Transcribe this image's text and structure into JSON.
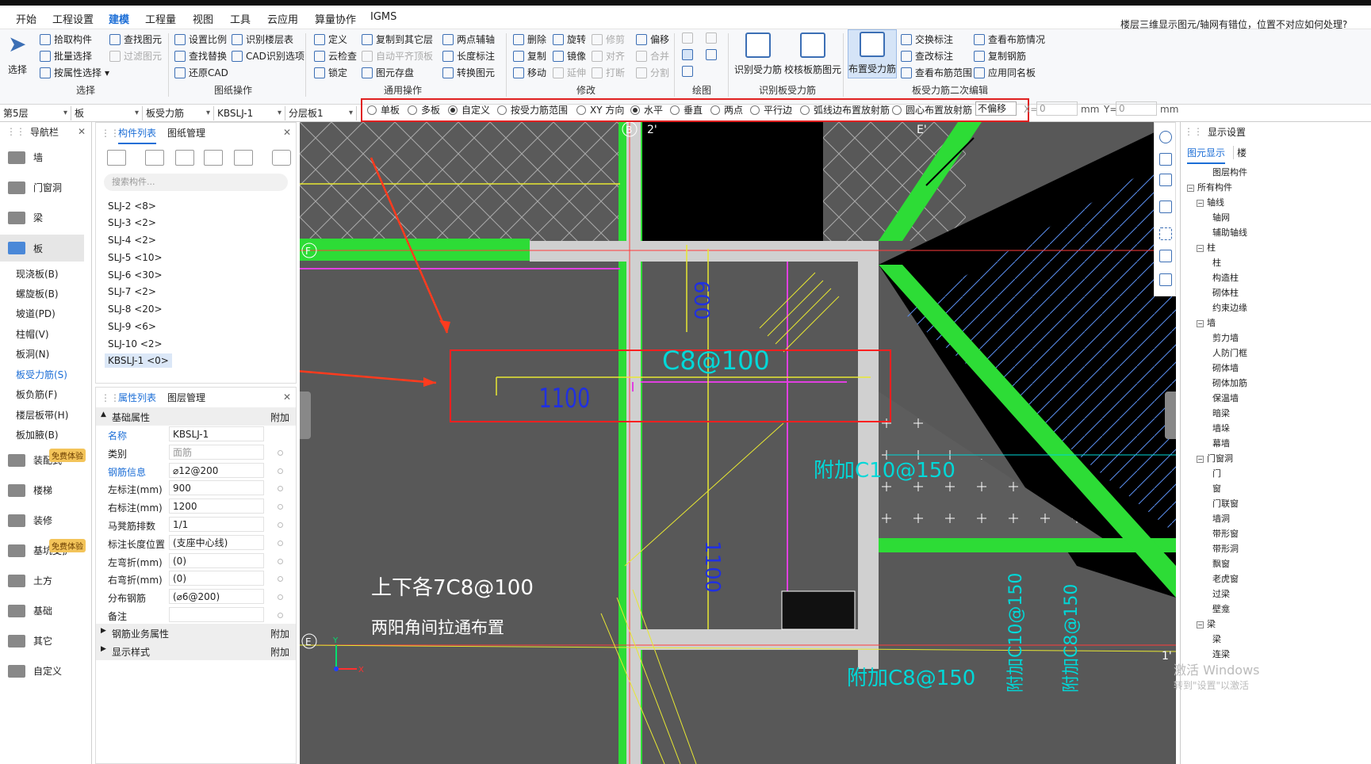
{
  "menu": [
    "开始",
    "工程设置",
    "建模",
    "工程量",
    "视图",
    "工具",
    "云应用",
    "算量协作",
    "IGMS"
  ],
  "hint": "楼层三维显示图元/轴网有错位，位置不对应如何处理?",
  "ribbon": {
    "select": {
      "big": "选择",
      "pick": "拾取构件",
      "batch": "批量选择",
      "byattr": "按属性选择",
      "group": "选择"
    },
    "find": {
      "findel": "查找图元",
      "filter": "过滤图元"
    },
    "drawing": {
      "scale": "设置比例",
      "replace": "查找替换",
      "restore": "还原CAD",
      "layer": "识别楼层表",
      "cadopt": "CAD识别选项",
      "group": "图纸操作"
    },
    "common": {
      "define": "定义",
      "cloud": "云检查",
      "lock": "锁定",
      "copyto": "复制到其它层",
      "autoflat": "自动平齐顶板",
      "store": "图元存盘",
      "twopt": "两点辅轴",
      "lenmark": "长度标注",
      "convert": "转换图元",
      "group": "通用操作"
    },
    "modify": {
      "delete": "删除",
      "copy": "复制",
      "move": "移动",
      "rotate": "旋转",
      "mirror": "镜像",
      "extend": "延伸",
      "trim": "修剪",
      "align": "对齐",
      "break": "打断",
      "offset": "偏移",
      "merge": "合并",
      "split": "分割",
      "group": "修改"
    },
    "draw": {
      "group": "绘图"
    },
    "recog": {
      "a": "识别受力筋",
      "b": "校核板筋图元",
      "group": "识别板受力筋"
    },
    "layout": {
      "big": "布置受力筋",
      "swap": "交换标注",
      "checklabel": "查改标注",
      "range": "查看布筋范围",
      "viewinfo": "查看布筋情况",
      "copyreb": "复制钢筋",
      "applysame": "应用同名板",
      "group": "板受力筋二次编辑"
    }
  },
  "propbar": {
    "floor": "第5层",
    "type": "板",
    "sub": "板受力筋",
    "comp": "KBSLJ-1",
    "layer": "分层板1"
  },
  "options": {
    "single": "单板",
    "multi": "多板",
    "custom": "自定义",
    "byrange": "按受力筋范围",
    "xy": "XY 方向",
    "horiz": "水平",
    "vert": "垂直",
    "twopt": "两点",
    "parallel": "平行边",
    "arc": "弧线边布置放射筋",
    "circle": "圆心布置放射筋",
    "offset": "不偏移",
    "x_label": "X=",
    "x_val": "0",
    "y_label": "Y=",
    "y_val": "0",
    "unit": "mm"
  },
  "nav": {
    "title": "导航栏",
    "items": [
      "墙",
      "门窗洞",
      "梁",
      "板"
    ],
    "subs": [
      "现浇板(B)",
      "螺旋板(B)",
      "坡道(PD)",
      "柱帽(V)",
      "板洞(N)",
      "板受力筋(S)",
      "板负筋(F)",
      "楼层板带(H)",
      "板加腋(B)"
    ],
    "more": [
      "装配式",
      "楼梯",
      "装修",
      "基坑支护",
      "土方",
      "基础",
      "其它",
      "自定义"
    ],
    "badge": "免费体验"
  },
  "complist": {
    "tab1": "构件列表",
    "tab2": "图纸管理",
    "search": "搜索构件...",
    "items": [
      "SLJ-2 <8>",
      "SLJ-3 <2>",
      "SLJ-4 <2>",
      "SLJ-5 <10>",
      "SLJ-6 <30>",
      "SLJ-7 <2>",
      "SLJ-8 <20>",
      "SLJ-9 <6>",
      "SLJ-10 <2>",
      "KBSLJ-1 <0>"
    ]
  },
  "proplist": {
    "tab1": "属性列表",
    "tab2": "图层管理",
    "base": "基础属性",
    "add": "附加",
    "rows": [
      [
        "名称",
        "KBSLJ-1"
      ],
      [
        "类别",
        "面筋"
      ],
      [
        "钢筋信息",
        "⌀12@200"
      ],
      [
        "左标注(mm)",
        "900"
      ],
      [
        "右标注(mm)",
        "1200"
      ],
      [
        "马凳筋排数",
        "1/1"
      ],
      [
        "标注长度位置",
        "(支座中心线)"
      ],
      [
        "左弯折(mm)",
        "(0)"
      ],
      [
        "右弯折(mm)",
        "(0)"
      ],
      [
        "分布钢筋",
        "(⌀6@200)"
      ],
      [
        "备注",
        ""
      ]
    ],
    "rebar": "钢筋业务属性",
    "display": "显示样式"
  },
  "cad": {
    "t1100": "1100",
    "c8": "C8@100",
    "t600": "600",
    "t1100v": "1100",
    "up": "上下各7C8@100",
    "two": "两阳角间拉通布置",
    "fj1": "附加C10@150",
    "fj2": "附加C10@150",
    "fj3": "附加C8@150",
    "fj4": "附加C8@150",
    "axF": "F",
    "axE": "E",
    "axB": "B",
    "ax2": "2'",
    "axEp": "E'",
    "ax1p": "1'",
    "x": "X",
    "y": "Y"
  },
  "right": {
    "title": "显示设置",
    "tab1": "图元显示",
    "tab2": "楼",
    "tree": [
      [
        "图层构件",
        0,
        false
      ],
      [
        "所有构件",
        0,
        true
      ],
      [
        "轴线",
        1,
        true
      ],
      [
        "轴网",
        2,
        false
      ],
      [
        "辅助轴线",
        2,
        false
      ],
      [
        "柱",
        1,
        true
      ],
      [
        "柱",
        2,
        false
      ],
      [
        "构造柱",
        2,
        false
      ],
      [
        "砌体柱",
        2,
        false
      ],
      [
        "约束边缘",
        2,
        false
      ],
      [
        "墙",
        1,
        true
      ],
      [
        "剪力墙",
        2,
        false
      ],
      [
        "人防门框",
        2,
        false
      ],
      [
        "砌体墙",
        2,
        false
      ],
      [
        "砌体加筋",
        2,
        false
      ],
      [
        "保温墙",
        2,
        false
      ],
      [
        "暗梁",
        2,
        false
      ],
      [
        "墙垛",
        2,
        false
      ],
      [
        "幕墙",
        2,
        false
      ],
      [
        "门窗洞",
        1,
        true
      ],
      [
        "门",
        2,
        false
      ],
      [
        "窗",
        2,
        false
      ],
      [
        "门联窗",
        2,
        false
      ],
      [
        "墙洞",
        2,
        false
      ],
      [
        "带形窗",
        2,
        false
      ],
      [
        "带形洞",
        2,
        false
      ],
      [
        "飘窗",
        2,
        false
      ],
      [
        "老虎窗",
        2,
        false
      ],
      [
        "过梁",
        2,
        false
      ],
      [
        "壁龛",
        2,
        false
      ],
      [
        "梁",
        1,
        true
      ],
      [
        "梁",
        2,
        false
      ],
      [
        "连梁",
        2,
        false
      ]
    ]
  },
  "watermark": [
    "激活 Windows",
    "转到\"设置\"以激活"
  ]
}
